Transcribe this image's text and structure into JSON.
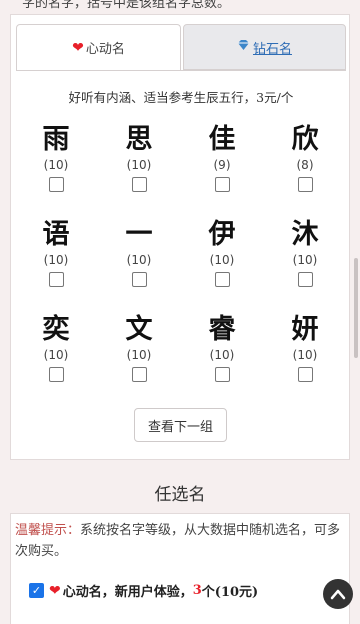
{
  "top_text": "字的名字，括号中是该组名字总数。",
  "tabs": [
    {
      "label": "心动名",
      "icon": "heart-icon"
    },
    {
      "label": "钻石名",
      "icon": "diamond-icon"
    }
  ],
  "subtitle": "好听有内涵、适当参考生辰五行，3元/个",
  "names": [
    {
      "char": "雨",
      "count": "(10)"
    },
    {
      "char": "思",
      "count": "(10)"
    },
    {
      "char": "佳",
      "count": "(9)"
    },
    {
      "char": "欣",
      "count": "(8)"
    },
    {
      "char": "语",
      "count": "(10)"
    },
    {
      "char": "一",
      "count": "(10)"
    },
    {
      "char": "伊",
      "count": "(10)"
    },
    {
      "char": "沐",
      "count": "(10)"
    },
    {
      "char": "奕",
      "count": "(10)"
    },
    {
      "char": "文",
      "count": "(10)"
    },
    {
      "char": "睿",
      "count": "(10)"
    },
    {
      "char": "妍",
      "count": "(10)"
    }
  ],
  "next_button": "查看下一组",
  "section_title": "任选名",
  "tip": {
    "label": "温馨提示：",
    "text": "系统按名字等级，从大数据中随机选名，可多次购买。"
  },
  "option": {
    "name": "心动名，新用户体验，",
    "count": "3",
    "suffix": "个(10元)"
  },
  "colors": {
    "accent_red": "#e8202a",
    "link_blue": "#2f6db5",
    "check_blue": "#1a73e8"
  }
}
